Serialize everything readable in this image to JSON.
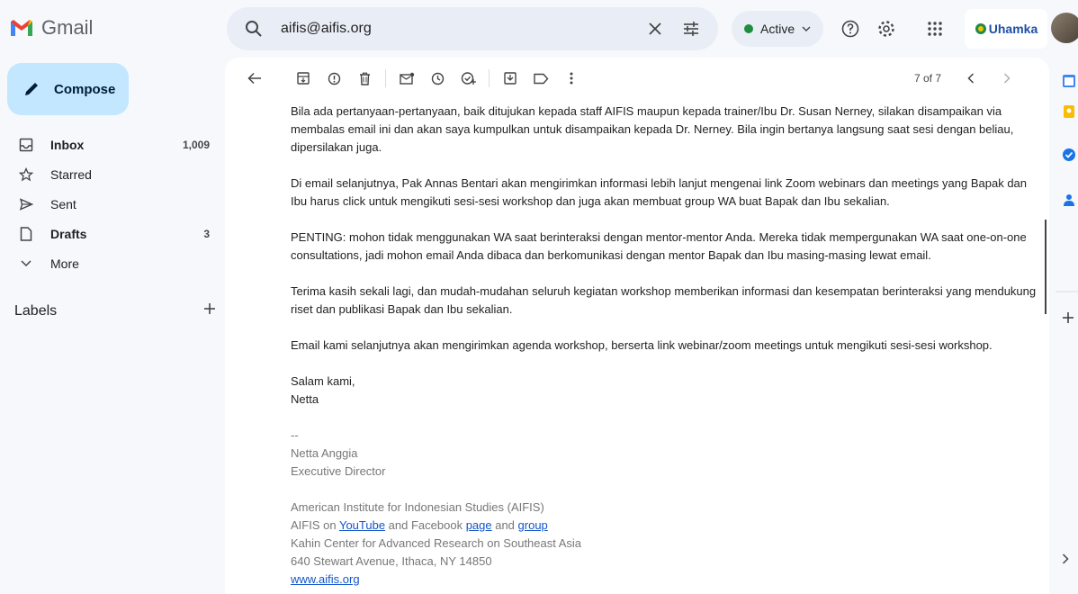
{
  "app": {
    "name": "Gmail"
  },
  "search": {
    "query": "aifis@aifis.org"
  },
  "status": {
    "label": "Active"
  },
  "org": {
    "name": "Uhamka"
  },
  "compose": {
    "label": "Compose"
  },
  "nav": [
    {
      "label": "Inbox",
      "count": "1,009",
      "bold": true
    },
    {
      "label": "Starred",
      "count": ""
    },
    {
      "label": "Sent",
      "count": ""
    },
    {
      "label": "Drafts",
      "count": "3",
      "bold": true
    },
    {
      "label": "More",
      "count": ""
    }
  ],
  "labels": {
    "title": "Labels"
  },
  "pager": {
    "text": "7 of 7"
  },
  "email": {
    "p1": "Bila ada pertanyaan-pertanyaan, baik ditujukan kepada staff AIFIS maupun kepada trainer/Ibu Dr. Susan Nerney, silakan disampaikan via membalas email ini dan akan saya kumpulkan untuk disampaikan kepada Dr. Nerney. Bila ingin bertanya langsung saat sesi dengan beliau, dipersilakan juga.",
    "p2": "Di email selanjutnya, Pak Annas Bentari akan mengirimkan informasi lebih lanjut mengenai link Zoom webinars dan meetings yang Bapak dan Ibu harus click untuk mengikuti sesi-sesi workshop dan juga akan membuat group WA buat Bapak dan Ibu sekalian.",
    "p3": "PENTING: mohon tidak menggunakan WA saat berinteraksi dengan mentor-mentor Anda. Mereka tidak mempergunakan WA saat one-on-one consultations, jadi mohon email Anda dibaca dan berkomunikasi dengan mentor Bapak dan Ibu masing-masing lewat email.",
    "p4": "Terima kasih sekali lagi, dan mudah-mudahan seluruh kegiatan workshop memberikan informasi dan kesempatan berinteraksi yang mendukung riset dan publikasi Bapak dan Ibu sekalian.",
    "p5": "Email kami selanjutnya akan mengirimkan agenda workshop, berserta link webinar/zoom meetings untuk mengikuti sesi-sesi workshop.",
    "closing": "Salam kami,",
    "sender": "Netta",
    "sig_dash": "--",
    "sig_name": "Netta Anggia",
    "sig_title": "Executive Director",
    "sig_org": "American Institute for Indonesian Studies (AIFIS)",
    "sig_line_a": "AIFIS on ",
    "sig_youtube": "YouTube",
    "sig_line_b": " and Facebook ",
    "sig_page": "page",
    "sig_line_c": " and ",
    "sig_group": "group",
    "sig_kahin": "Kahin Center for Advanced Research on Southeast Asia",
    "sig_addr": "640 Stewart Avenue, Ithaca, NY 14850",
    "sig_web": "www.aifis.org"
  }
}
